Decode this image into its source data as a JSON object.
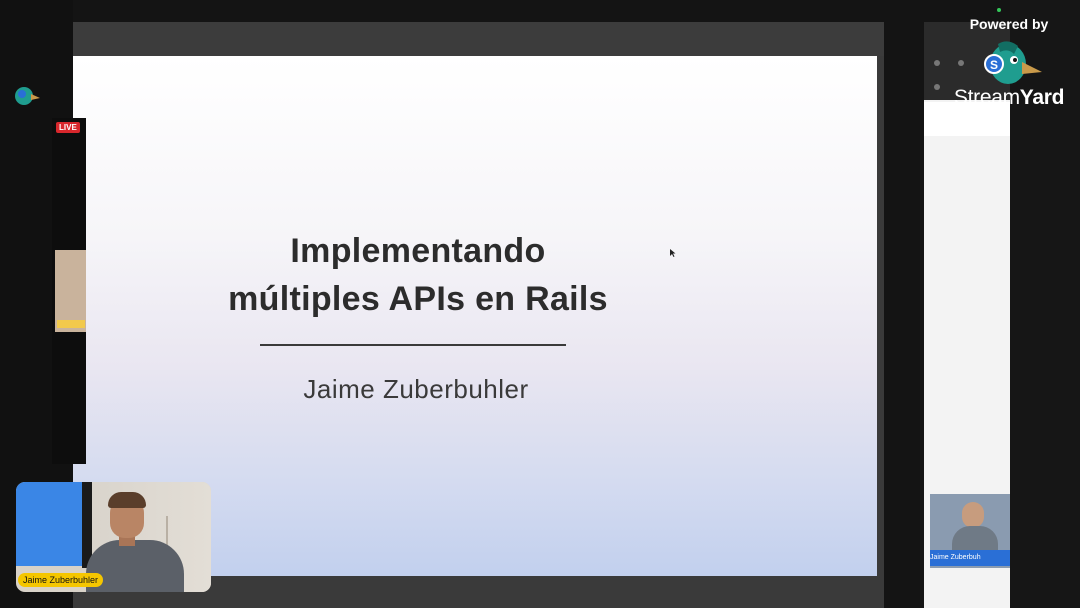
{
  "slide": {
    "title_line1": "Implementando",
    "title_line2": "múltiples APIs en Rails",
    "author": "Jaime Zuberbuhler"
  },
  "branding": {
    "powered_by": "Powered by",
    "brand_part1": "Stream",
    "brand_part2": "Yard"
  },
  "presenter_camera": {
    "name_label": "Jaime Zuberbuhler",
    "label_color": "#f5c600"
  },
  "side_panel": {
    "live_badge": "LIVE",
    "camera_label": "Jaime Zuberbuh"
  },
  "colors": {
    "live_red": "#d8272c",
    "streamyard_blue": "#2a6fd6"
  }
}
